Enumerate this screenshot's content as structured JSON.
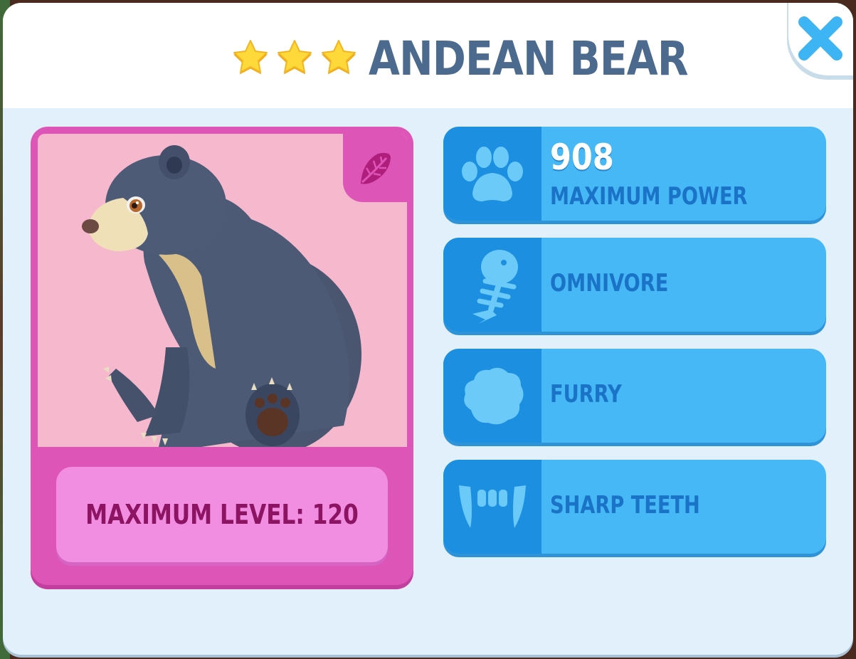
{
  "header": {
    "title": "ANDEAN BEAR",
    "star_rating": 3,
    "max_stars": 3
  },
  "close_button": {
    "icon": "close-icon"
  },
  "animal_card": {
    "biome_icon": "leaf-icon",
    "portrait": "andean-bear-portrait",
    "max_level_label": "MAXIMUM LEVEL: 120"
  },
  "stats": [
    {
      "icon": "paw-icon",
      "value": "908",
      "label": "MAXIMUM POWER"
    },
    {
      "icon": "fish-bone-icon",
      "label": "OMNIVORE"
    },
    {
      "icon": "fur-tuft-icon",
      "label": "FURRY"
    },
    {
      "icon": "fangs-icon",
      "label": "SHARP TEETH"
    }
  ],
  "colors": {
    "title": "#4b6a8e",
    "card": "#de55b8",
    "level_text": "#8c1462",
    "stat_row": "#47b8f6",
    "stat_icon_box": "#1c8fe0",
    "stat_label": "#1a73c6",
    "close": "#3db4f4"
  }
}
